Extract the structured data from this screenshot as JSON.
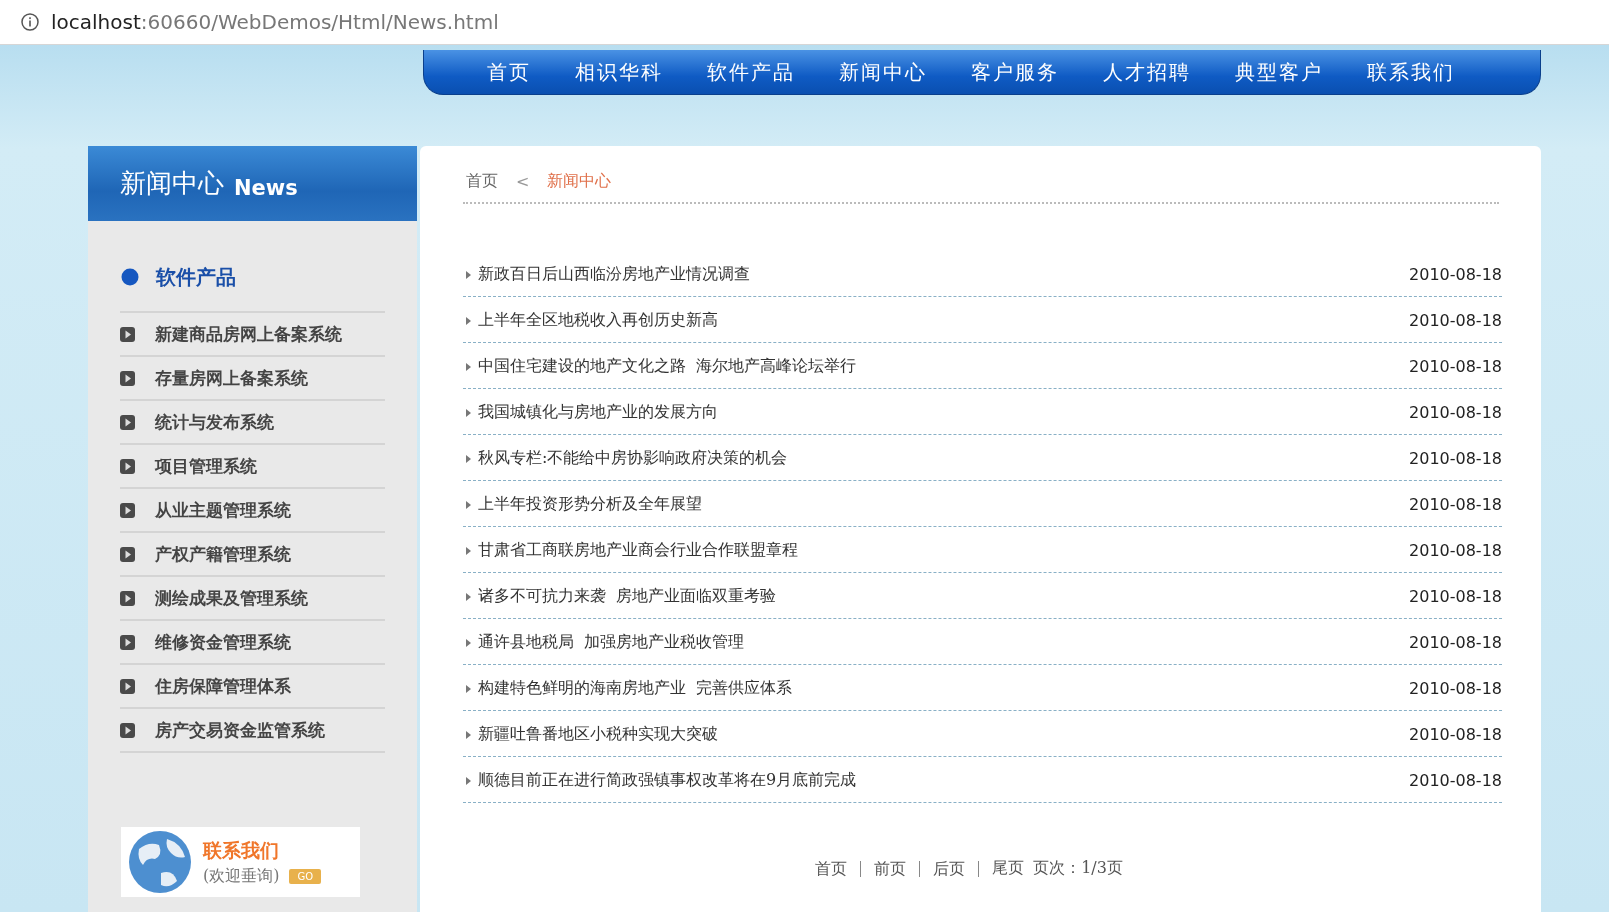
{
  "address_bar": {
    "host": "localhost",
    "path": ":60660/WebDemos/Html/News.html"
  },
  "nav": {
    "items": [
      "首页",
      "相识华科",
      "软件产品",
      "新闻中心",
      "客户服务",
      "人才招聘",
      "典型客户",
      "联系我们"
    ]
  },
  "sidebar": {
    "title": "新闻中心",
    "title_en": "News",
    "category": "软件产品",
    "items": [
      "新建商品房网上备案系统",
      "存量房网上备案系统",
      "统计与发布系统",
      "项目管理系统",
      "从业主题管理系统",
      "产权产籍管理系统",
      "测绘成果及管理系统",
      "维修资金管理系统",
      "住房保障管理体系",
      "房产交易资金监管系统"
    ],
    "contact": {
      "title": "联系我们",
      "subtitle": "(欢迎垂询)",
      "button": "GO"
    }
  },
  "breadcrumb": {
    "home": "首页",
    "separator": "<",
    "current": "新闻中心"
  },
  "news": [
    {
      "title": "新政百日后山西临汾房地产业情况调查",
      "date": "2010-08-18"
    },
    {
      "title": "上半年全区地税收入再创历史新高",
      "date": "2010-08-18"
    },
    {
      "title": "中国住宅建设的地产文化之路  海尔地产高峰论坛举行",
      "date": "2010-08-18"
    },
    {
      "title": "我国城镇化与房地产业的发展方向",
      "date": "2010-08-18"
    },
    {
      "title": "秋风专栏:不能给中房协影响政府决策的机会",
      "date": "2010-08-18"
    },
    {
      "title": "上半年投资形势分析及全年展望",
      "date": "2010-08-18"
    },
    {
      "title": "甘肃省工商联房地产业商会行业合作联盟章程",
      "date": "2010-08-18"
    },
    {
      "title": "诸多不可抗力来袭  房地产业面临双重考验",
      "date": "2010-08-18"
    },
    {
      "title": "通许县地税局  加强房地产业税收管理",
      "date": "2010-08-18"
    },
    {
      "title": "构建特色鲜明的海南房地产业  完善供应体系",
      "date": "2010-08-18"
    },
    {
      "title": "新疆吐鲁番地区小税种实现大突破",
      "date": "2010-08-18"
    },
    {
      "title": "顺德目前正在进行简政强镇事权改革将在9月底前完成",
      "date": "2010-08-18"
    }
  ],
  "pagination": {
    "links": [
      "首页",
      "前页",
      "后页",
      "尾页"
    ],
    "info": "页次：1/3页"
  }
}
